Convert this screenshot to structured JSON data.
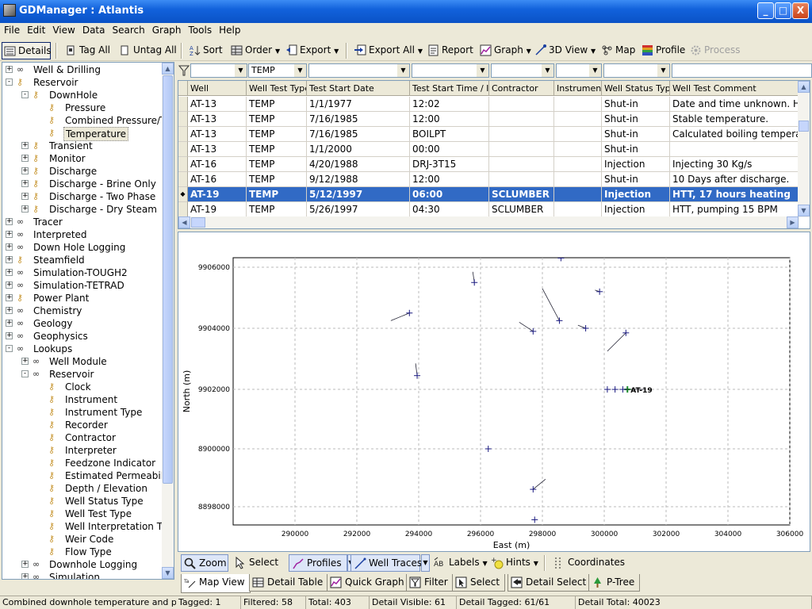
{
  "window": {
    "title": "GDManager : Atlantis",
    "min": "_",
    "max": "□",
    "close": "X"
  },
  "menu": [
    "File",
    "Edit",
    "View",
    "Data",
    "Search",
    "Graph",
    "Tools",
    "Help"
  ],
  "toolbar": {
    "details": "Details",
    "tag_all": "Tag All",
    "untag_all": "Untag All",
    "sort": "Sort",
    "order": "Order",
    "export": "Export",
    "export_all": "Export All",
    "report": "Report",
    "graph": "Graph",
    "view3d": "3D View",
    "map": "Map",
    "profile": "Profile",
    "process": "Process"
  },
  "tree": [
    {
      "label": "Well & Drilling",
      "level": 0,
      "exp": "+",
      "icon": "glasses"
    },
    {
      "label": "Reservoir",
      "level": 0,
      "exp": "-",
      "icon": "key"
    },
    {
      "label": "DownHole",
      "level": 1,
      "exp": "-",
      "icon": "key"
    },
    {
      "label": "Pressure",
      "level": 2,
      "exp": "",
      "icon": "key"
    },
    {
      "label": "Combined Pressure/Te",
      "level": 2,
      "exp": "",
      "icon": "key"
    },
    {
      "label": "Temperature",
      "level": 2,
      "exp": "",
      "icon": "key",
      "selected": true
    },
    {
      "label": "Transient",
      "level": 1,
      "exp": "+",
      "icon": "key"
    },
    {
      "label": "Monitor",
      "level": 1,
      "exp": "+",
      "icon": "key"
    },
    {
      "label": "Discharge",
      "level": 1,
      "exp": "+",
      "icon": "key"
    },
    {
      "label": "Discharge - Brine Only",
      "level": 1,
      "exp": "+",
      "icon": "key"
    },
    {
      "label": "Discharge - Two Phase",
      "level": 1,
      "exp": "+",
      "icon": "key"
    },
    {
      "label": "Discharge - Dry Steam",
      "level": 1,
      "exp": "+",
      "icon": "key"
    },
    {
      "label": "Tracer",
      "level": 0,
      "exp": "+",
      "icon": "glasses"
    },
    {
      "label": "Interpreted",
      "level": 0,
      "exp": "+",
      "icon": "glasses"
    },
    {
      "label": "Down Hole Logging",
      "level": 0,
      "exp": "+",
      "icon": "glasses"
    },
    {
      "label": "Steamfield",
      "level": 0,
      "exp": "+",
      "icon": "key"
    },
    {
      "label": "Simulation-TOUGH2",
      "level": 0,
      "exp": "+",
      "icon": "glasses"
    },
    {
      "label": "Simulation-TETRAD",
      "level": 0,
      "exp": "+",
      "icon": "glasses"
    },
    {
      "label": "Power Plant",
      "level": 0,
      "exp": "+",
      "icon": "key"
    },
    {
      "label": "Chemistry",
      "level": 0,
      "exp": "+",
      "icon": "glasses"
    },
    {
      "label": "Geology",
      "level": 0,
      "exp": "+",
      "icon": "glasses"
    },
    {
      "label": "Geophysics",
      "level": 0,
      "exp": "+",
      "icon": "glasses"
    },
    {
      "label": "Lookups",
      "level": 0,
      "exp": "-",
      "icon": "glasses"
    },
    {
      "label": "Well Module",
      "level": 1,
      "exp": "+",
      "icon": "glasses"
    },
    {
      "label": "Reservoir",
      "level": 1,
      "exp": "-",
      "icon": "glasses"
    },
    {
      "label": "Clock",
      "level": 2,
      "exp": "",
      "icon": "key"
    },
    {
      "label": "Instrument",
      "level": 2,
      "exp": "",
      "icon": "key"
    },
    {
      "label": "Instrument Type",
      "level": 2,
      "exp": "",
      "icon": "key"
    },
    {
      "label": "Recorder",
      "level": 2,
      "exp": "",
      "icon": "key"
    },
    {
      "label": "Contractor",
      "level": 2,
      "exp": "",
      "icon": "key"
    },
    {
      "label": "Interpreter",
      "level": 2,
      "exp": "",
      "icon": "key"
    },
    {
      "label": "Feedzone Indicator",
      "level": 2,
      "exp": "",
      "icon": "key"
    },
    {
      "label": "Estimated Permeability",
      "level": 2,
      "exp": "",
      "icon": "key"
    },
    {
      "label": "Depth / Elevation",
      "level": 2,
      "exp": "",
      "icon": "key"
    },
    {
      "label": "Well Status Type",
      "level": 2,
      "exp": "",
      "icon": "key"
    },
    {
      "label": "Well Test Type",
      "level": 2,
      "exp": "",
      "icon": "key"
    },
    {
      "label": "Well Interpretation Ty",
      "level": 2,
      "exp": "",
      "icon": "key"
    },
    {
      "label": "Weir Code",
      "level": 2,
      "exp": "",
      "icon": "key"
    },
    {
      "label": "Flow Type",
      "level": 2,
      "exp": "",
      "icon": "key"
    },
    {
      "label": "Downhole Logging",
      "level": 1,
      "exp": "+",
      "icon": "glasses"
    },
    {
      "label": "Simulation",
      "level": 1,
      "exp": "+",
      "icon": "glasses"
    }
  ],
  "filter": {
    "well_test_type": "TEMP"
  },
  "grid": {
    "columns": [
      "Well",
      "Well Test Type",
      "Test Start Date",
      "Test Start Time / ID",
      "Contractor",
      "Instrument",
      "Well Status Type",
      "Well Test Comment"
    ],
    "rows": [
      [
        "AT-13",
        "TEMP",
        "1/1/1977",
        "12:02",
        "",
        "",
        "Shut-in",
        "Date and time unknown. He"
      ],
      [
        "AT-13",
        "TEMP",
        "7/16/1985",
        "12:00",
        "",
        "",
        "Shut-in",
        "Stable temperature."
      ],
      [
        "AT-13",
        "TEMP",
        "7/16/1985",
        "BOILPT",
        "",
        "",
        "Shut-in",
        "Calculated boiling temperatu"
      ],
      [
        "AT-13",
        "TEMP",
        "1/1/2000",
        "00:00",
        "",
        "",
        "Shut-in",
        ""
      ],
      [
        "AT-16",
        "TEMP",
        "4/20/1988",
        "DRJ-3T15",
        "",
        "",
        "Injection",
        "Injecting 30 Kg/s"
      ],
      [
        "AT-16",
        "TEMP",
        "9/12/1988",
        "12:00",
        "",
        "",
        "Shut-in",
        "10 Days after discharge."
      ],
      [
        "AT-19",
        "TEMP",
        "5/12/1997",
        "06:00",
        "SCLUMBER",
        "",
        "Injection",
        "HTT, 17 hours heating"
      ],
      [
        "AT-19",
        "TEMP",
        "5/26/1997",
        "04:30",
        "SCLUMBER",
        "",
        "Injection",
        "HTT, pumping 15 BPM"
      ]
    ],
    "selected_row": 6
  },
  "chart_data": {
    "type": "scatter",
    "xlabel": "East (m)",
    "ylabel": "North (m)",
    "xlim": [
      288000,
      306000
    ],
    "ylim": [
      8897500,
      9906300
    ],
    "xticks": [
      290000,
      292000,
      294000,
      296000,
      298000,
      300000,
      302000,
      304000,
      306000
    ],
    "yticks": [
      8898000,
      8900000,
      9902000,
      9904000,
      9906000
    ],
    "grid": true,
    "wells": [
      {
        "x": 293700,
        "y": 9904500,
        "trace": [
          [
            293100,
            9904250
          ]
        ],
        "label": ""
      },
      {
        "x": 293950,
        "y": 9902450,
        "trace": [
          [
            293900,
            9902850
          ]
        ],
        "label": ""
      },
      {
        "x": 295800,
        "y": 9905500,
        "trace": [
          [
            295750,
            9905850
          ]
        ],
        "label": ""
      },
      {
        "x": 298600,
        "y": 9906300,
        "trace": [],
        "label": ""
      },
      {
        "x": 298550,
        "y": 9904250,
        "trace": [
          [
            298000,
            9905300
          ]
        ],
        "label": ""
      },
      {
        "x": 297700,
        "y": 9903900,
        "trace": [
          [
            297250,
            9904200
          ]
        ],
        "label": ""
      },
      {
        "x": 299400,
        "y": 9904000,
        "trace": [
          [
            299150,
            9904100
          ]
        ],
        "label": ""
      },
      {
        "x": 299850,
        "y": 9905200,
        "trace": [
          [
            299700,
            9905250
          ]
        ],
        "label": ""
      },
      {
        "x": 300700,
        "y": 9903850,
        "trace": [
          [
            300100,
            9903250
          ]
        ],
        "label": ""
      },
      {
        "x": 300750,
        "y": 9901150,
        "trace": [
          [
            301300,
            9901600
          ]
        ],
        "label": "AT-19",
        "highlight": true
      },
      {
        "x": 300100,
        "y": 9900950,
        "trace": [],
        "label": ""
      },
      {
        "x": 300350,
        "y": 9901000,
        "trace": [],
        "label": ""
      },
      {
        "x": 300600,
        "y": 9901050,
        "trace": [
          [
            300800,
            9900950
          ]
        ],
        "label": ""
      },
      {
        "x": 296250,
        "y": 8900050,
        "trace": [],
        "label": ""
      },
      {
        "x": 297700,
        "y": 8898600,
        "trace": [
          [
            298100,
            8898950
          ]
        ],
        "label": ""
      },
      {
        "x": 297750,
        "y": 8897550,
        "trace": [],
        "label": ""
      }
    ]
  },
  "mapbar": {
    "zoom": "Zoom",
    "select": "Select",
    "profiles": "Profiles",
    "well_traces": "Well Traces",
    "labels": "Labels",
    "hints": "Hints",
    "coordinates": "Coordinates"
  },
  "tabs": [
    "Map View",
    "Detail Table",
    "Quick Graph",
    "Filter",
    "Select",
    "Detail Select",
    "P-Tree"
  ],
  "status": {
    "desc": "Combined downhole temperature and pressur",
    "tagged": "Tagged: 1",
    "filtered": "Filtered: 58",
    "total": "Total: 403",
    "detail_visible": "Detail Visible: 61",
    "detail_tagged": "Detail Tagged: 61/61",
    "detail_total": "Detail Total: 40023"
  },
  "colors": {
    "selection": "#316ac5",
    "titlebar": "#0a52c6",
    "well_marker": "#1a1a80",
    "highlight_marker": "#1a8a2a"
  }
}
